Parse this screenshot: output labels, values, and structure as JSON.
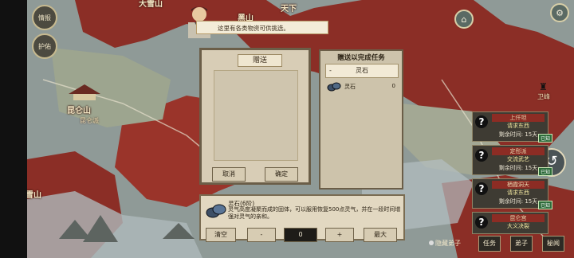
{
  "map": {
    "labels": [
      "天下",
      "黑山",
      "昆仑山",
      "雪山",
      "大雪山"
    ],
    "sub_labels": [
      "昆仑派",
      "卫峰"
    ]
  },
  "left_buttons": [
    "情报",
    "护佑"
  ],
  "npc": {
    "speech": "这里有各类物资可供挑选。"
  },
  "gift": {
    "title": "赠送",
    "cancel_label": "取消",
    "confirm_label": "确定"
  },
  "task": {
    "title": "赠送以完成任务",
    "selected": "灵石",
    "selected_prefix": "-",
    "items": [
      {
        "name": "灵石",
        "count": "0"
      }
    ]
  },
  "info": {
    "name": "灵石(6阶)",
    "desc": "灵气高度凝聚而成的固体，可以服用恢复500点灵气，并在一段时间增强对灵气的亲和。"
  },
  "qty": {
    "clear_label": "清空",
    "minus_label": "-",
    "value": "0",
    "plus_label": "+",
    "max_label": "最大"
  },
  "quests": [
    {
      "title": "上仟坦",
      "sub": "请求东西",
      "time": "剩余时间: 15天",
      "tag": "已知"
    },
    {
      "title": "定彤派",
      "sub": "交流武艺",
      "time": "剩余时间: 15天",
      "tag": "已知"
    },
    {
      "title": "栖霞洞天",
      "sub": "请求东西",
      "time": "剩余时间: 15天",
      "tag": "已知"
    },
    {
      "title": "昆仑宫",
      "sub": "大义决裂",
      "time": "",
      "tag": ""
    }
  ],
  "bottom": {
    "hide_disciples": "隐藏弟子",
    "tasks": "任务",
    "disciples": "弟子",
    "secret": "秘闻"
  },
  "icons": [
    "settings-icon",
    "back-icon",
    "hat-icon"
  ]
}
